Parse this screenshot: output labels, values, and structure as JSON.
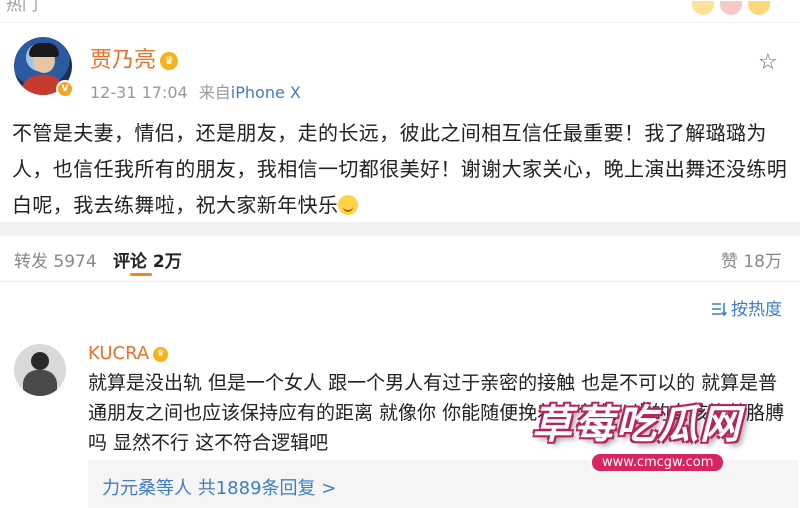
{
  "header": {
    "hot_tag": "热门"
  },
  "post": {
    "author": "贾乃亮",
    "timestamp": "12-31 17:04",
    "source_prefix": "来自",
    "source": "iPhone X",
    "text": "不管是夫妻，情侣，还是朋友，走的长远，彼此之间相互信任最重要！我了解璐璐为人，也信任我所有的朋友，我相信一切都很美好！谢谢大家关心，晚上演出舞还没练明白呢，我去练舞啦，祝大家新年快乐"
  },
  "tabs": {
    "repost": "转发 5974",
    "comment": "评论 2万",
    "like": "赞 18万"
  },
  "sort": {
    "label": "按热度"
  },
  "comment": {
    "author": "KUCRA",
    "text": "就算是没出轨 但是一个女人 跟一个男人有过于亲密的接触 也是不可以的 就算是普通朋友之间也应该保持应有的距离 就像你 你能随便挽着一个十八岁的女孩挽着胳膊吗 显然不行 这不符合逻辑吧",
    "replies": "力元桑等人  共1889条回复 >"
  },
  "watermark": {
    "title": "草莓吃瓜网",
    "url": "www.cmcgw.com"
  },
  "colors": {
    "accent": "#e8702a",
    "link": "#3d7ec6",
    "tab_indicator": "#f08526"
  }
}
